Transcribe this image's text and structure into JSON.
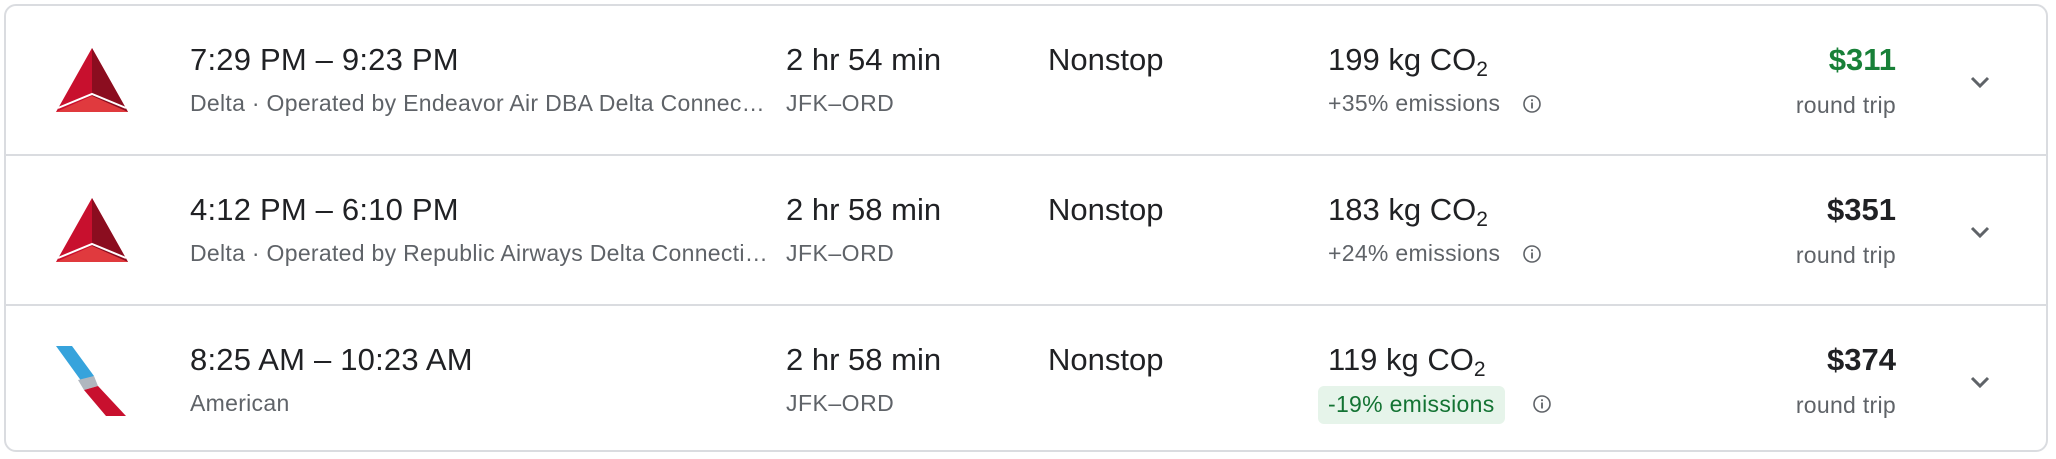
{
  "flights": [
    {
      "airline_logo": "delta-logo",
      "times": "7:29 PM – 9:23 PM",
      "airline": "Delta · Operated by Endeavor Air DBA Delta Connection",
      "duration": "2 hr 54 min",
      "route": "JFK–ORD",
      "stops": "Nonstop",
      "co2_amount": "199 kg CO",
      "co2_sub": "2",
      "emissions": "+35% emissions",
      "price": "$311",
      "trip_type": "round trip"
    },
    {
      "airline_logo": "delta-logo",
      "times": "4:12 PM – 6:10 PM",
      "airline": "Delta · Operated by Republic Airways Delta Connection",
      "duration": "2 hr 58 min",
      "route": "JFK–ORD",
      "stops": "Nonstop",
      "co2_amount": "183 kg CO",
      "co2_sub": "2",
      "emissions": "+24% emissions",
      "price": "$351",
      "trip_type": "round trip"
    },
    {
      "airline_logo": "american-logo",
      "times": "8:25 AM – 10:23 AM",
      "airline": "American",
      "duration": "2 hr 58 min",
      "route": "JFK–ORD",
      "stops": "Nonstop",
      "co2_amount": "119 kg CO",
      "co2_sub": "2",
      "emissions": "-19% emissions",
      "price": "$374",
      "trip_type": "round trip"
    }
  ],
  "colors": {
    "cheapest_price": "#188038",
    "low_emissions_bg": "#e6f4ea",
    "low_emissions_text": "#137333",
    "delta_red": "#c8102e",
    "american_blue": "#36a3dc",
    "american_red": "#c8102e"
  },
  "icons": {
    "info": "info-icon",
    "expand": "chevron-down-icon"
  }
}
